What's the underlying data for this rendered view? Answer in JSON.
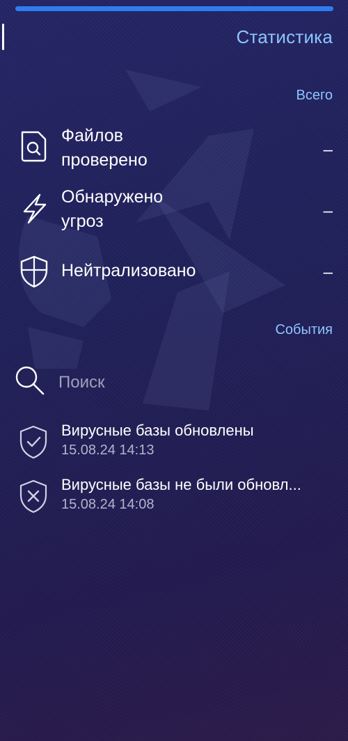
{
  "header": {
    "title": "Статистика"
  },
  "totals": {
    "section_label": "Всего",
    "items": [
      {
        "label_line1": "Файлов",
        "label_line2": "проверено",
        "value": "–",
        "icon": "file-search-icon"
      },
      {
        "label_line1": "Обнаружено",
        "label_line2": "угроз",
        "value": "–",
        "icon": "lightning-icon"
      },
      {
        "label_line1": "Нейтрализовано",
        "label_line2": "",
        "value": "–",
        "icon": "shield-icon"
      }
    ]
  },
  "events": {
    "section_label": "События",
    "search": {
      "placeholder": "Поиск",
      "value": ""
    },
    "items": [
      {
        "title": "Вирусные базы обновлены",
        "time": "15.08.24 14:13",
        "icon": "shield-check-icon"
      },
      {
        "title": "Вирусные базы не были обновл...",
        "time": "15.08.24 14:08",
        "icon": "shield-x-icon"
      }
    ]
  },
  "colors": {
    "accent": "#8fc5ff",
    "progress": "#2f7cf0",
    "background": "#232463"
  }
}
